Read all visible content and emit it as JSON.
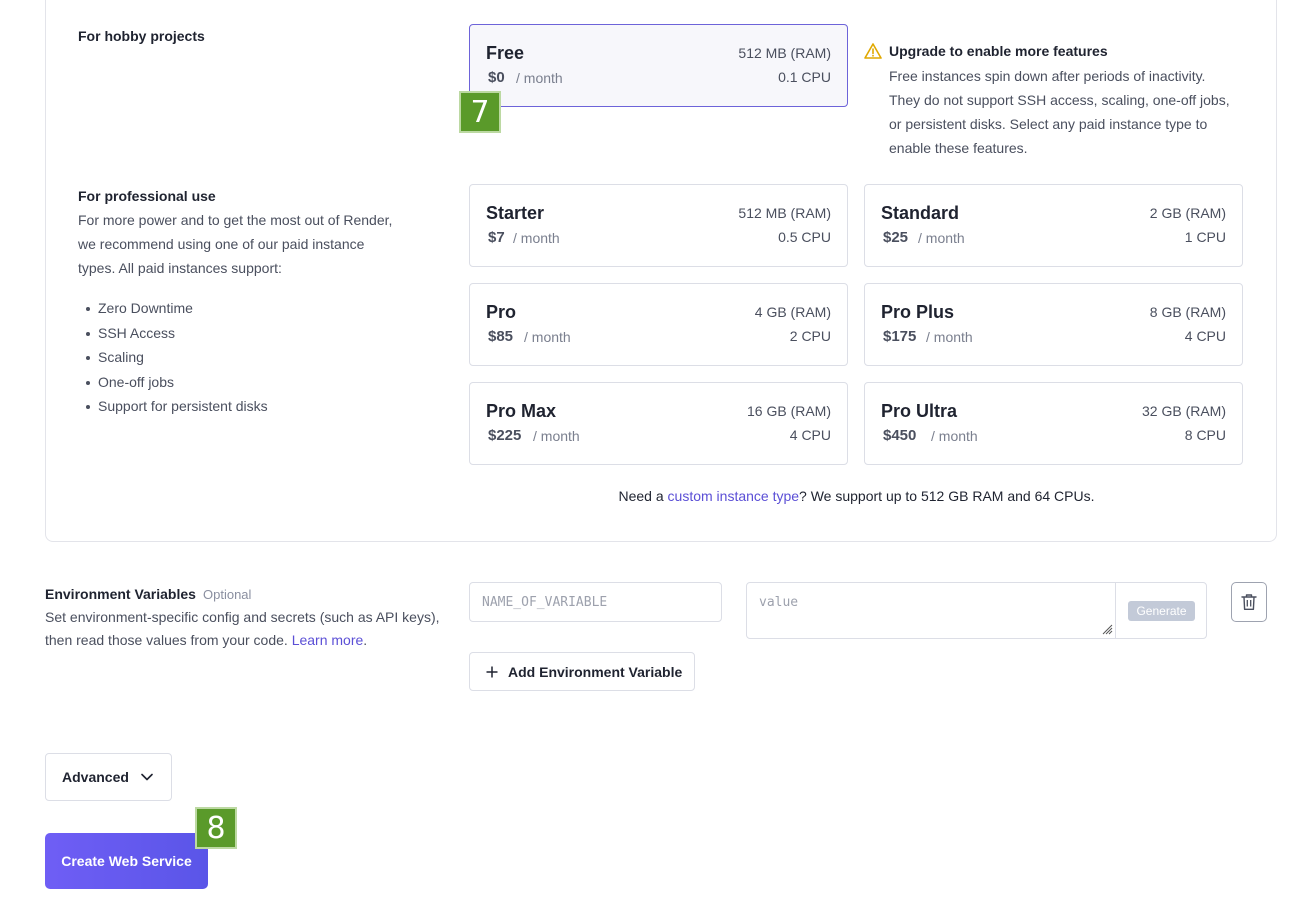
{
  "hobby": {
    "title": "For hobby projects"
  },
  "professional": {
    "title": "For professional use",
    "description": "For more power and to get the most out of Render, we recommend using one of our paid instance types. All paid instances support:",
    "features": [
      "Zero Downtime",
      "SSH Access",
      "Scaling",
      "One-off jobs",
      "Support for persistent disks"
    ]
  },
  "instances": {
    "free": {
      "name": "Free",
      "price": "$0",
      "per": "/ month",
      "ram": "512 MB (RAM)",
      "cpu": "0.1 CPU",
      "selected": true
    },
    "starter": {
      "name": "Starter",
      "price": "$7",
      "per": "/ month",
      "ram": "512 MB (RAM)",
      "cpu": "0.5 CPU"
    },
    "standard": {
      "name": "Standard",
      "price": "$25",
      "per": "/ month",
      "ram": "2 GB (RAM)",
      "cpu": "1 CPU"
    },
    "pro": {
      "name": "Pro",
      "price": "$85",
      "per": "/ month",
      "ram": "4 GB (RAM)",
      "cpu": "2 CPU"
    },
    "pro_plus": {
      "name": "Pro Plus",
      "price": "$175",
      "per": "/ month",
      "ram": "8 GB (RAM)",
      "cpu": "4 CPU"
    },
    "pro_max": {
      "name": "Pro Max",
      "price": "$225",
      "per": "/ month",
      "ram": "16 GB (RAM)",
      "cpu": "4 CPU"
    },
    "pro_ultra": {
      "name": "Pro Ultra",
      "price": "$450",
      "per": "/ month",
      "ram": "32 GB (RAM)",
      "cpu": "8 CPU"
    }
  },
  "upgrade_notice": {
    "icon": "warning-icon",
    "title": "Upgrade to enable more features",
    "body": "Free instances spin down after periods of inactivity. They do not support SSH access, scaling, one-off jobs, or persistent disks. Select any paid instance type to enable these features."
  },
  "custom_instance": {
    "prefix": "Need a ",
    "link": "custom instance type",
    "suffix": "? We support up to 512 GB RAM and 64 CPUs."
  },
  "env": {
    "title": "Environment Variables",
    "optional": "Optional",
    "description": "Set environment-specific config and secrets (such as API keys), then read those values from your code. ",
    "learn_more": "Learn more",
    "period": ".",
    "name_placeholder": "NAME_OF_VARIABLE",
    "value_placeholder": "value",
    "generate_label": "Generate",
    "add_label": "Add Environment Variable"
  },
  "advanced_label": "Advanced",
  "create_label": "Create Web Service",
  "badges": {
    "free_card": "7",
    "create_button": "8"
  },
  "colors": {
    "accent": "#5b4fd6",
    "badge": "#5a9a2a",
    "create_button": "#6359ee"
  }
}
